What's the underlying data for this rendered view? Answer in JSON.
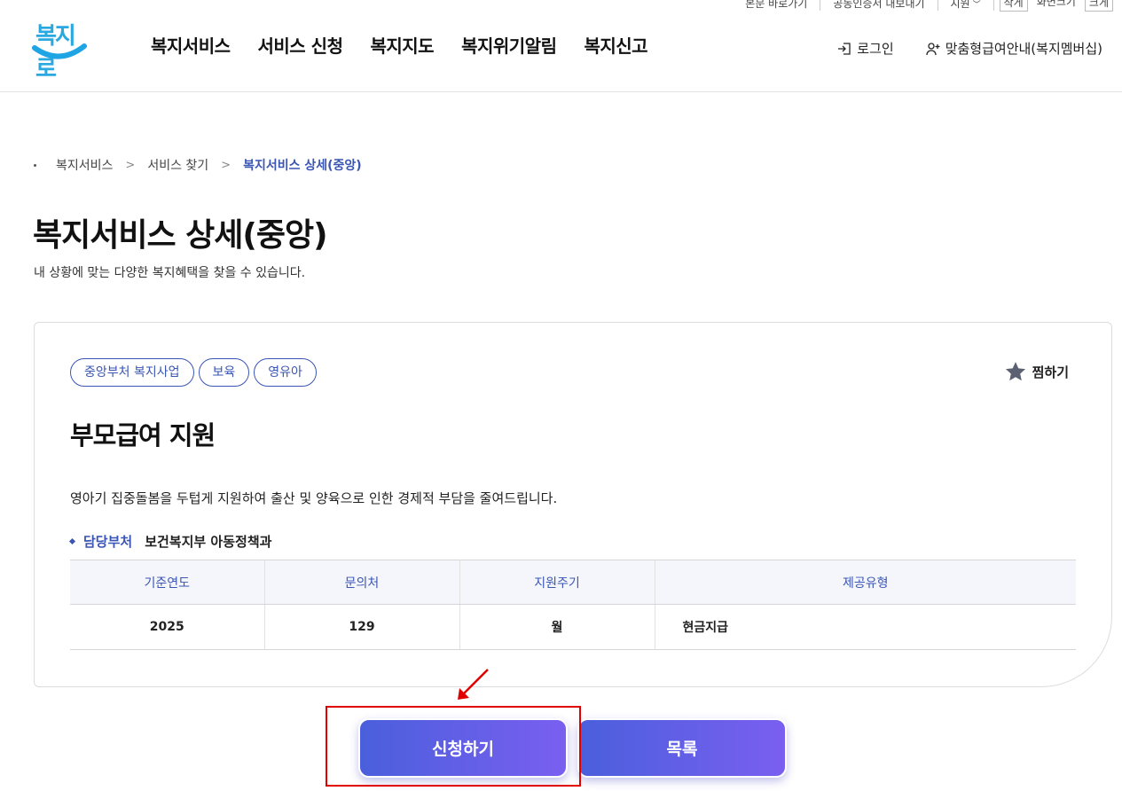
{
  "util_bar": {
    "skip_link": "본문 바로가기",
    "cert_link": "공동인증서 내보내기",
    "region_select": "지원",
    "size_small": "작게",
    "size_label": "화면크기",
    "size_large": "크게"
  },
  "header": {
    "logo_text": "복지로",
    "nav": [
      "복지서비스",
      "서비스 신청",
      "복지지도",
      "복지위기알림",
      "복지신고"
    ],
    "login": "로그인",
    "membership": "맞춤형급여안내(복지멤버십)"
  },
  "breadcrumb": [
    "복지서비스",
    "서비스 찾기",
    "복지서비스 상세(중앙)"
  ],
  "page": {
    "title": "복지서비스 상세(중앙)",
    "description": "내 상황에 맞는 다양한 복지혜택을 찾을 수 있습니다."
  },
  "service": {
    "tags": [
      "중앙부처 복지사업",
      "보육",
      "영유아"
    ],
    "favorite_label": "찜하기",
    "title": "부모급여 지원",
    "description": "영아기 집중돌봄을 두텁게 지원하여 출산 및 양육으로 인한 경제적 부담을 줄여드립니다.",
    "dept_label": "담당부처",
    "dept_value": "보건복지부 아동정책과",
    "table": {
      "headers": [
        "기준연도",
        "문의처",
        "지원주기",
        "제공유형"
      ],
      "row": [
        "2025",
        "129",
        "월",
        "현금지급"
      ]
    }
  },
  "buttons": {
    "apply": "신청하기",
    "list": "목록"
  },
  "colors": {
    "accent": "#3a55b4",
    "button_start": "#4a5fdc",
    "button_end": "#7a5ff0",
    "highlight": "#e00000"
  }
}
